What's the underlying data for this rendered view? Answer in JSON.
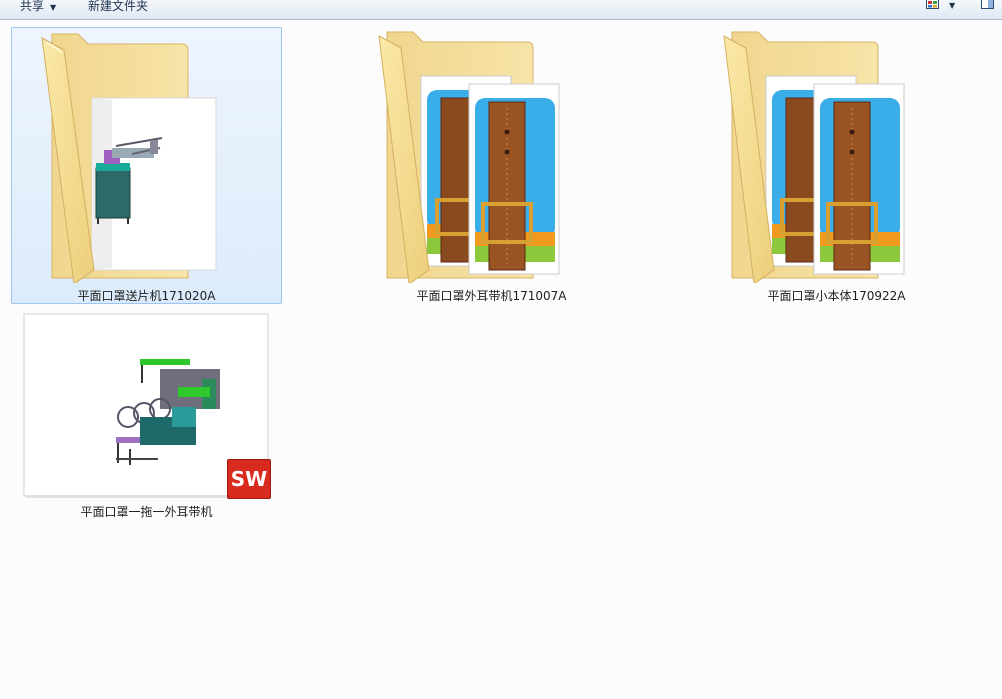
{
  "toolbar": {
    "share_label": "共享",
    "new_folder_label": "新建文件夹"
  },
  "icons": {
    "view": "view-thumbnails-icon",
    "preview_pane": "preview-pane-icon",
    "folder": "folder-icon",
    "winrar": "winrar-archive-icon",
    "solidworks": "solidworks-logo-icon"
  },
  "solidworks_badge": "SW",
  "items": [
    {
      "name": "平面口罩送片机171020A",
      "type": "folder",
      "preview": "machine",
      "selected": true
    },
    {
      "name": "平面口罩外耳带机171007A",
      "type": "folder",
      "preview": "archives",
      "selected": false
    },
    {
      "name": "平面口罩小本体170922A",
      "type": "folder",
      "preview": "archives",
      "selected": false
    },
    {
      "name": "平面口罩一拖一外耳带机",
      "type": "solidworks-file",
      "preview": "assembly",
      "selected": false
    }
  ],
  "colors": {
    "selection_bg": "#dcebfb",
    "selection_border": "#9cc5ef",
    "folder_yellow": "#f3d78a",
    "winrar_blue": "#3aaee8",
    "winrar_orange": "#f29a1e",
    "winrar_green": "#8cc83c",
    "solidworks_red": "#d82a1e"
  }
}
